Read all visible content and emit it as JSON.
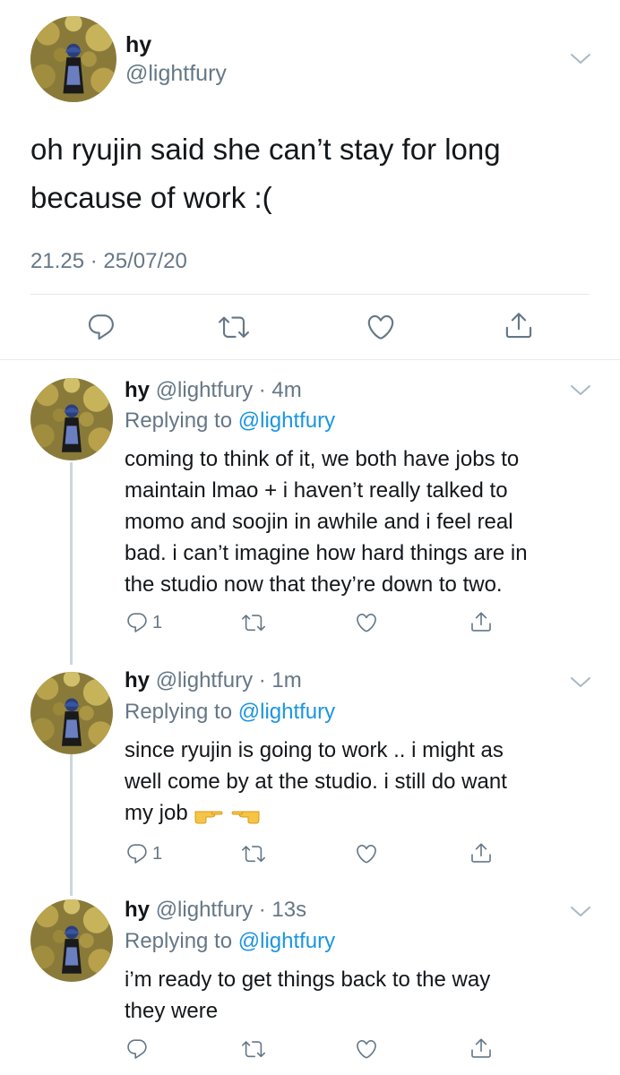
{
  "main_tweet": {
    "display_name": "hy",
    "handle": "@lightfury",
    "text_line1": "oh ryujin said she can’t stay for long",
    "text_line2": "because of work :(",
    "timestamp": "21.25 · 25/07/20"
  },
  "replies": [
    {
      "display_name": "hy",
      "meta": "@lightfury · 4m",
      "replying_prefix": "Replying to ",
      "replying_handle": "@lightfury",
      "lines": [
        "coming to think of it, we both have jobs to",
        "maintain lmao + i haven’t really talked to",
        "momo and soojin in awhile and i feel real",
        "bad. i can’t imagine how hard things are in",
        "the studio now that they’re down to two."
      ],
      "reply_count": "1"
    },
    {
      "display_name": "hy",
      "meta": "@lightfury · 1m",
      "replying_prefix": "Replying to ",
      "replying_handle": "@lightfury",
      "lines": [
        "since ryujin is going to work .. i might as",
        "well come by at the studio. i still do want",
        "my job"
      ],
      "emoji": [
        "pointing-right-hand",
        "pointing-left-hand"
      ],
      "reply_count": "1"
    },
    {
      "display_name": "hy",
      "meta": "@lightfury · 13s",
      "replying_prefix": "Replying to ",
      "replying_handle": "@lightfury",
      "lines": [
        "i’m ready to get things back to the way",
        "they were"
      ],
      "reply_count": ""
    }
  ],
  "icons": [
    "reply-icon",
    "retweet-icon",
    "like-icon",
    "share-icon",
    "chevron-down-icon"
  ],
  "colors": {
    "text": "#14171a",
    "secondary": "#657786",
    "link": "#1b95e0",
    "divider": "#e6ecf0",
    "thread_line": "#ccd6dd"
  }
}
